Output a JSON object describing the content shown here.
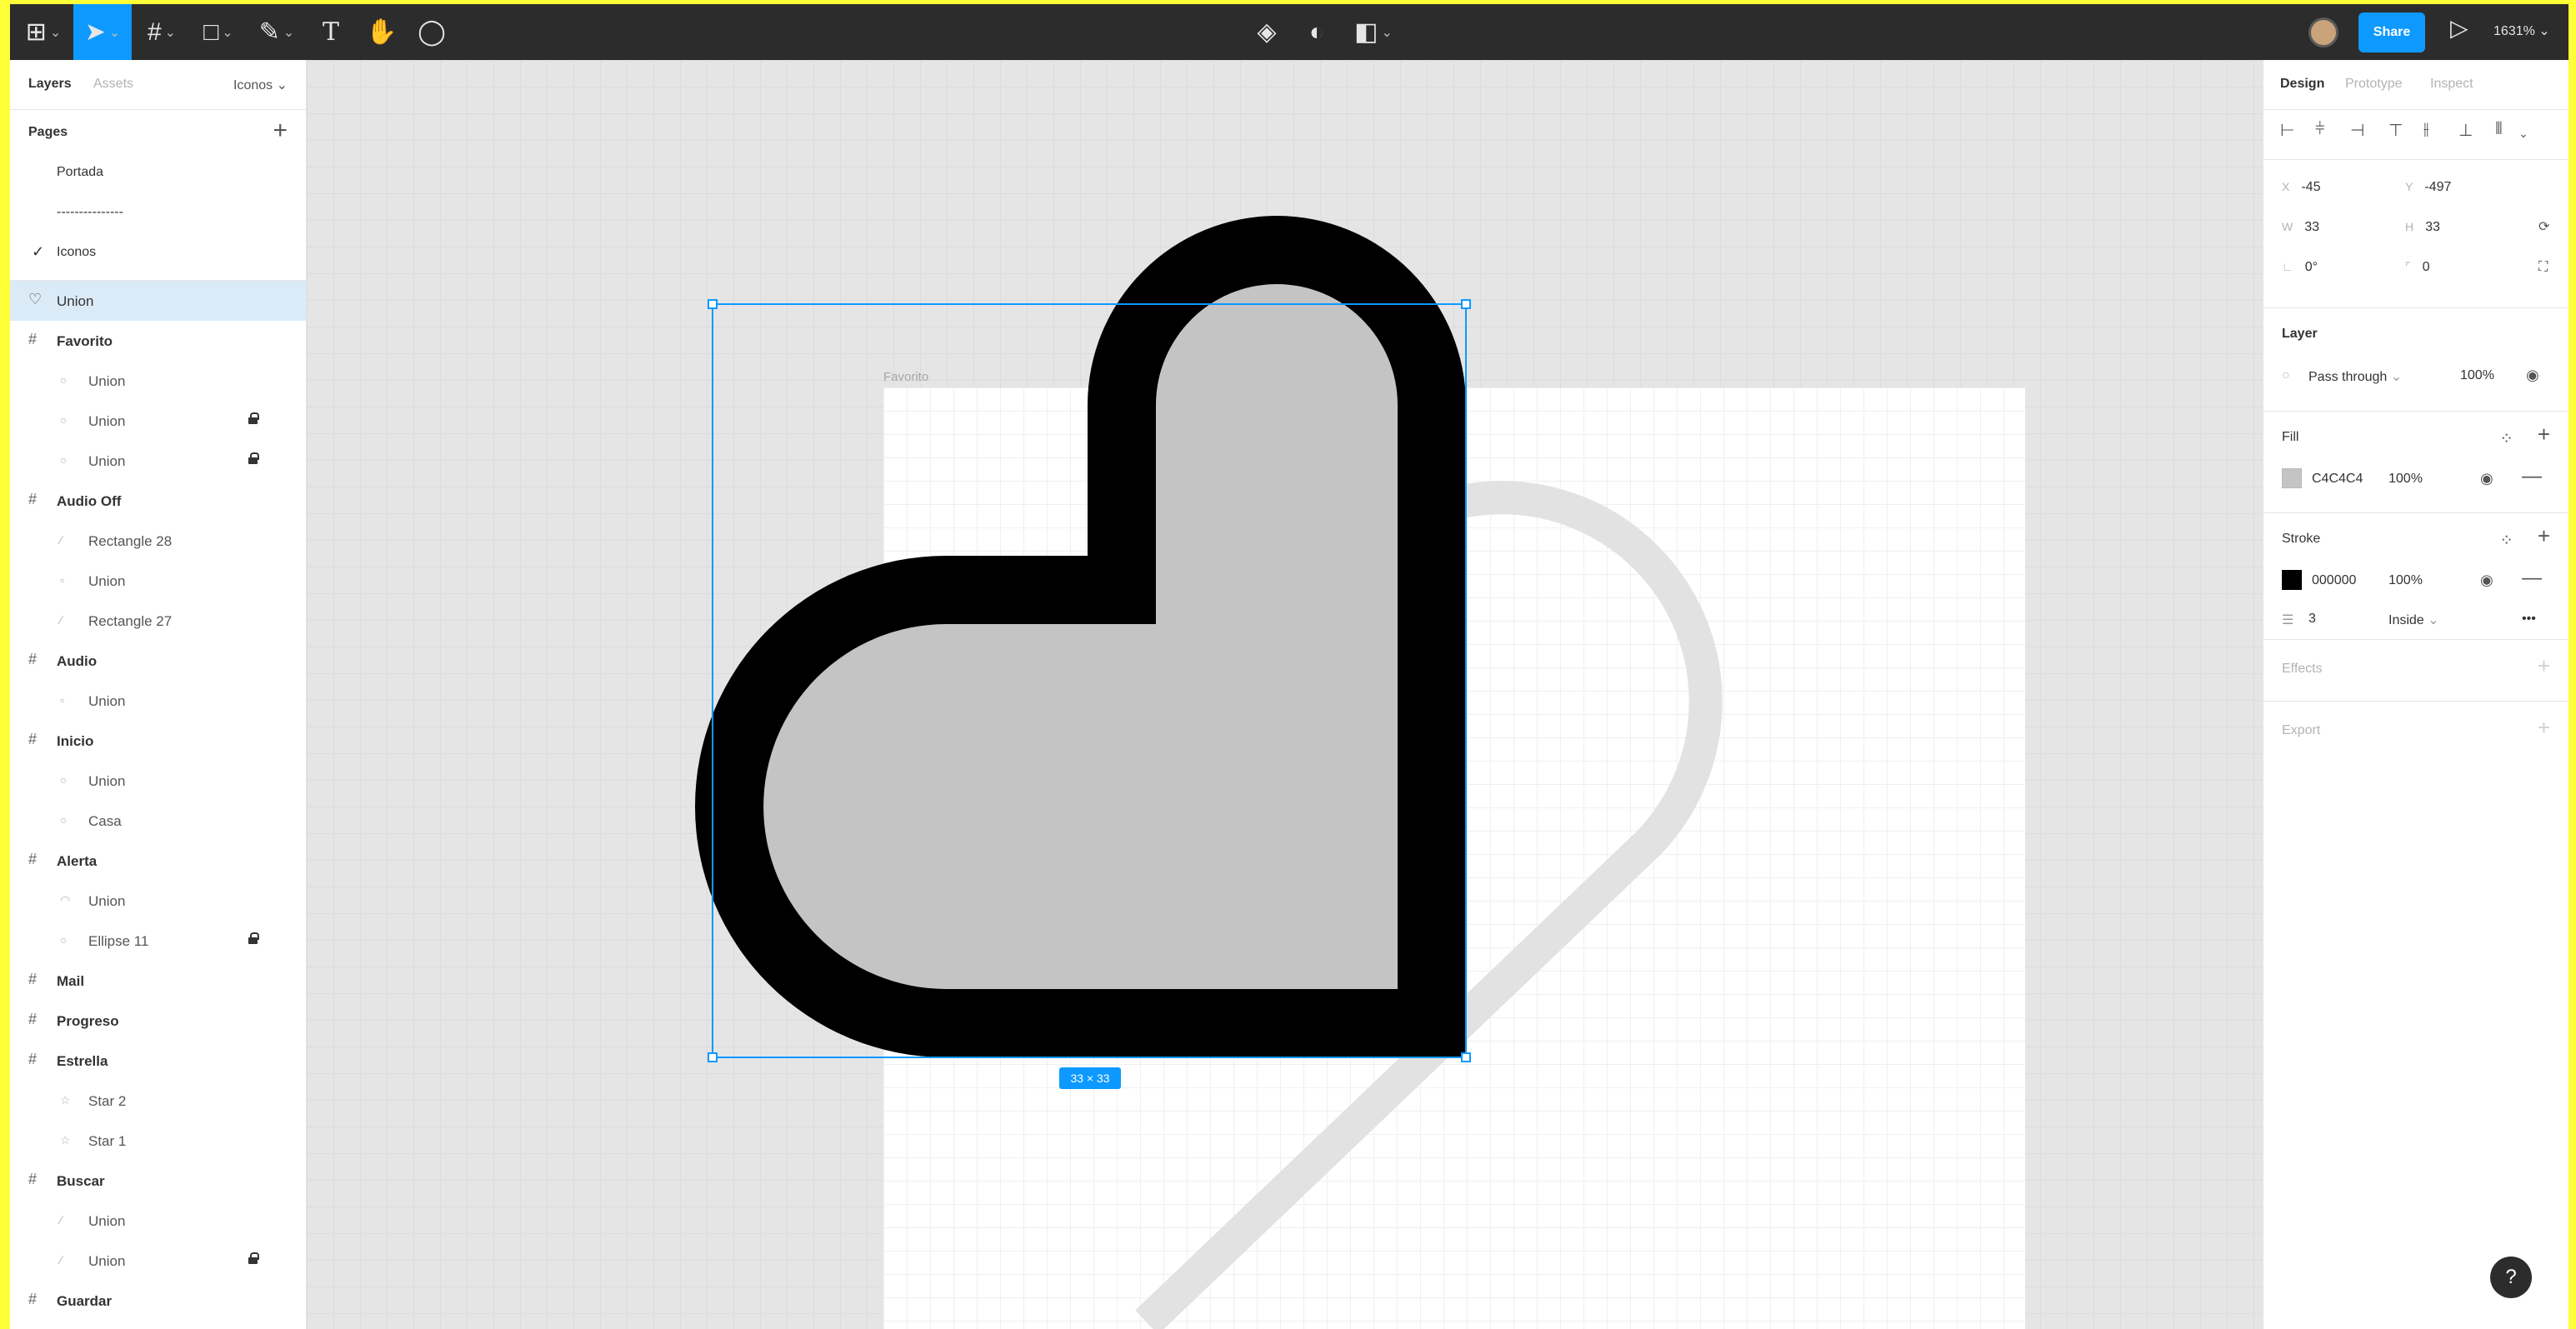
{
  "toolbar": {
    "zoom": "1631%",
    "share_label": "Share",
    "text_tool": "T"
  },
  "left_panel": {
    "tab_layers": "Layers",
    "tab_assets": "Assets",
    "page_selector": "Iconos",
    "pages_title": "Pages",
    "add_symbol": "+",
    "pages": [
      {
        "label": "Portada"
      },
      {
        "label": "---------------"
      },
      {
        "label": "Iconos",
        "current": true
      }
    ],
    "layers": [
      {
        "label": "Union"
      },
      {
        "label": "Favorito"
      },
      {
        "label": "Union"
      },
      {
        "label": "Union"
      },
      {
        "label": "Union"
      },
      {
        "label": "Audio Off"
      },
      {
        "label": "Rectangle 28"
      },
      {
        "label": "Union"
      },
      {
        "label": "Rectangle 27"
      },
      {
        "label": "Audio"
      },
      {
        "label": "Union"
      },
      {
        "label": "Inicio"
      },
      {
        "label": "Union"
      },
      {
        "label": "Casa"
      },
      {
        "label": "Alerta"
      },
      {
        "label": "Union"
      },
      {
        "label": "Ellipse 11"
      },
      {
        "label": "Mail"
      },
      {
        "label": "Progreso"
      },
      {
        "label": "Estrella"
      },
      {
        "label": "Star 2"
      },
      {
        "label": "Star 1"
      },
      {
        "label": "Buscar"
      },
      {
        "label": "Union"
      },
      {
        "label": "Union"
      },
      {
        "label": "Guardar"
      }
    ]
  },
  "canvas": {
    "frame_label": "Favorito",
    "size_badge": "33 × 33"
  },
  "right_panel": {
    "tab_design": "Design",
    "tab_prototype": "Prototype",
    "tab_inspect": "Inspect",
    "x_label": "X",
    "x_value": "-45",
    "y_label": "Y",
    "y_value": "-497",
    "w_label": "W",
    "w_value": "33",
    "h_label": "H",
    "h_value": "33",
    "rotation": "0°",
    "radius": "0",
    "layer_title": "Layer",
    "blend_mode": "Pass through",
    "layer_opacity": "100%",
    "fill_title": "Fill",
    "fill_color": "C4C4C4",
    "fill_opacity": "100%",
    "fill_swatch": "#C4C4C4",
    "stroke_title": "Stroke",
    "stroke_color": "000000",
    "stroke_opacity": "100%",
    "stroke_swatch": "#000000",
    "stroke_weight": "3",
    "stroke_position": "Inside",
    "stroke_more": "•••",
    "effects_title": "Effects",
    "export_title": "Export",
    "add_symbol": "+",
    "remove_symbol": "—"
  },
  "help_label": "?"
}
